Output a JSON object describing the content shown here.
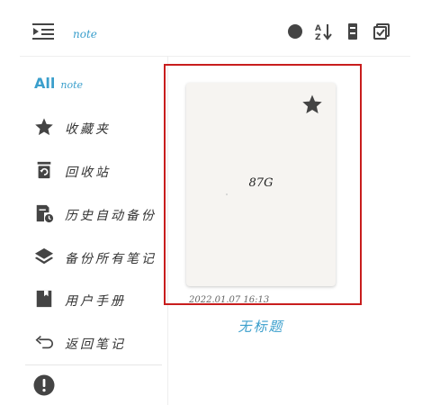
{
  "header": {
    "title": "note",
    "icons": [
      "menu-collapse-icon",
      "search-icon",
      "sort-icon",
      "delete-icon",
      "select-icon"
    ]
  },
  "sidebar": {
    "all_label": "All",
    "all_sub": "note",
    "items": [
      {
        "label": "收藏夹",
        "icon": "star-icon"
      },
      {
        "label": "回收站",
        "icon": "trash-icon"
      },
      {
        "label": "历史自动备份",
        "icon": "history-backup-icon"
      },
      {
        "label": "备份所有笔记",
        "icon": "layers-icon"
      },
      {
        "label": "用户手册",
        "icon": "book-icon"
      },
      {
        "label": "返回笔记",
        "icon": "back-arrow-icon"
      }
    ],
    "info_icon": "info-icon"
  },
  "note_card": {
    "content": "87G",
    "date": "2022.01.07 16:13",
    "title": "无标题",
    "favorite": true
  },
  "colors": {
    "accent": "#3b9fcc",
    "highlight": "#c81d1d",
    "icon": "#444444",
    "card_bg": "#f6f4f1"
  }
}
